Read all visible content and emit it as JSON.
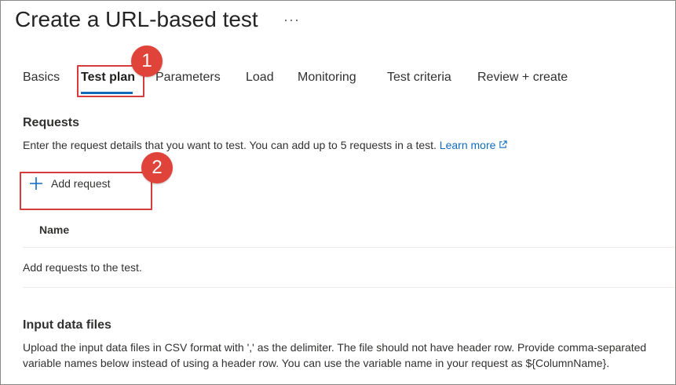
{
  "header": {
    "title": "Create a URL-based test",
    "more_label": "···"
  },
  "tabs": [
    {
      "label": "Basics",
      "active": false
    },
    {
      "label": "Test plan",
      "active": true
    },
    {
      "label": "Parameters",
      "active": false
    },
    {
      "label": "Load",
      "active": false
    },
    {
      "label": "Monitoring",
      "active": false
    },
    {
      "label": "Test criteria",
      "active": false
    },
    {
      "label": "Review + create",
      "active": false
    }
  ],
  "requests": {
    "title": "Requests",
    "description": "Enter the request details that you want to test. You can add up to 5 requests in a test.",
    "learn_more": "Learn more",
    "add_button": "Add request",
    "table": {
      "columns": [
        "Name"
      ],
      "empty_message": "Add requests to the test."
    }
  },
  "input_files": {
    "title": "Input data files",
    "description": "Upload the input data files in CSV format with ',' as the delimiter. The file should not have header row. Provide comma-separated variable names below instead of using a header row. You can use the variable name in your request as ${ColumnName}."
  },
  "callouts": [
    {
      "number": "1"
    },
    {
      "number": "2"
    }
  ],
  "colors": {
    "accent": "#0f6cbd",
    "callout": "#e0433a"
  }
}
